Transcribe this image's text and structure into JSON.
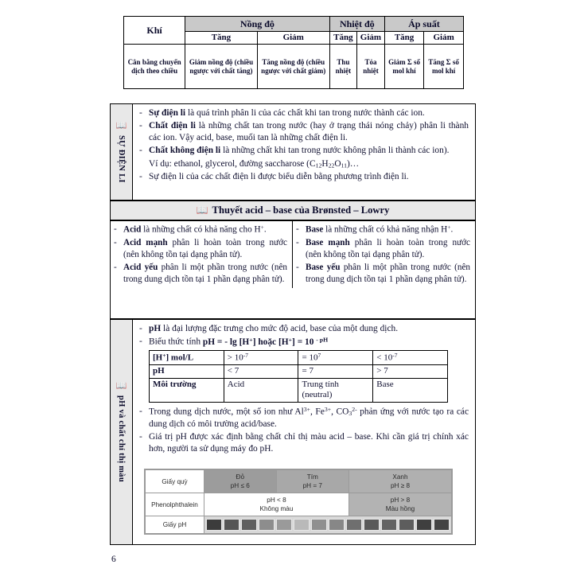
{
  "page": {
    "number": "6"
  },
  "equilibrium_table": {
    "col1_header": "Khí",
    "group_headers": [
      "Nồng độ",
      "Nhiệt độ",
      "Áp suất"
    ],
    "sub_headers": [
      "Tăng",
      "Giảm",
      "Tăng",
      "Giảm",
      "Tăng",
      "Giảm"
    ],
    "row_label": "Cân bằng chuyển dịch theo chiều",
    "cells": [
      "Giảm nồng độ (chiều ngược với chất tăng)",
      "Tăng nồng độ (chiều ngược với chất giảm)",
      "Thu nhiệt",
      "Tỏa nhiệt",
      "Giảm Σ số mol khí",
      "Tăng Σ số mol khí"
    ]
  },
  "section_dienli": {
    "sidebar_icon": "book-icon",
    "sidebar_label": "SỰ ĐIỆN LI",
    "items": [
      {
        "dash": true,
        "html": "<b>Sự điện li</b> là quá trình phân li của các chất khi tan trong nước thành các ion."
      },
      {
        "dash": true,
        "html": "<b>Chất điện li</b> là những chất tan trong nước (hay ở trạng thái nóng chảy) phân li thành các ion. Vậy acid, base, muối tan là những chất điện li."
      },
      {
        "dash": true,
        "html": "<b>Chất không điện li</b> là những chất khi tan trong nước không phân li thành các ion)."
      },
      {
        "dash": false,
        "html": "Ví dụ: ethanol, glycerol, đường saccharose (C<sub>12</sub>H<sub>22</sub>O<sub>11</sub>)…"
      },
      {
        "dash": true,
        "html": "Sự điện li của các chất điện li được biểu diễn bằng phương trình điện li."
      }
    ]
  },
  "theory_header": {
    "icon": "book-icon",
    "title": "Thuyết acid – base của Brønsted – Lowry"
  },
  "acid_base": {
    "acid_items": [
      "<b>Acid</b> là những chất có khả năng cho H<sup>+</sup>.",
      "<b>Acid mạnh</b> phân li hoàn toàn trong nước (nên không tồn tại dạng phân tử).",
      "<b>Acid yếu</b> phân li một phần trong nước (nên trong dung dịch tồn tại 1 phần dạng phân tử)."
    ],
    "base_items": [
      "<b>Base</b> là những chất có khả năng nhận H<sup>+</sup>.",
      "<b>Base mạnh</b> phân li hoàn toàn trong nước (nên không tồn tại dạng phân tử).",
      "<b>Base yếu</b> phân li một phần trong nước (nên trong dung dịch tồn tại 1 phần dạng phân tử)."
    ]
  },
  "section_ph": {
    "sidebar_icon": "book-icon",
    "sidebar_label": "pH và chất chỉ thị màu",
    "intro_items": [
      "<b>pH</b> là đại lượng đặc trưng cho mức độ acid, base của một dung dịch.",
      "Biểu thức tính <b>pH = - lg [H<sup>+</sup>] hoặc [H<sup>+</sup>] = 10 <sup>- pH</sup></b>"
    ],
    "ph_table": {
      "rows": [
        {
          "label": "[H<sup>+</sup>] mol/L",
          "values": [
            "&gt; 10<sup>-7</sup>",
            "= 10<sup>7</sup>",
            "&lt; 10<sup>-7</sup>"
          ]
        },
        {
          "label": "pH",
          "values": [
            "&lt; 7",
            "= 7",
            "&gt; 7"
          ]
        },
        {
          "label": "Môi trường",
          "values": [
            "Acid",
            "Trung tính (neutral)",
            "Base"
          ]
        }
      ]
    },
    "outro_items": [
      "Trong dung dịch nước, một số ion như Al<sup>3+</sup>, Fe<sup>3+</sup>, CO<sub>3</sub><sup>2-</sup> phản ứng với nước tạo ra các dung dịch có môi trường acid/base.",
      "Giá trị pH được xác định bằng chất chỉ thị màu acid – base. Khi cần giá trị chính xác hơn, người ta sử dụng máy đo pH."
    ]
  },
  "indicator_chart": {
    "rows": [
      {
        "name": "Giấy quỳ",
        "cells": [
          {
            "line1": "Đỏ",
            "line2": "pH ≤ 6",
            "shade": "red"
          },
          {
            "line1": "Tím",
            "line2": "pH = 7",
            "shade": "purple"
          },
          {
            "line1": "Xanh",
            "line2": "pH ≥ 8",
            "shade": "green"
          }
        ]
      },
      {
        "name": "Phenolphthalein",
        "cells": [
          {
            "line1": "pH < 8",
            "line2": "Không màu",
            "shade": "white"
          },
          {
            "line1": "pH > 8",
            "line2": "Màu hồng",
            "shade": "pink"
          }
        ]
      },
      {
        "name": "Giấy pH",
        "swatches": [
          "#3c3c3c",
          "#555555",
          "#5f5f5f",
          "#8d8d8d",
          "#9a9a9a",
          "#b9b9b9",
          "#8f8f8f",
          "#878787",
          "#6f6f6f",
          "#5a5a5a",
          "#636363",
          "#5d5d5d",
          "#3f3f3f",
          "#434343"
        ]
      }
    ]
  }
}
